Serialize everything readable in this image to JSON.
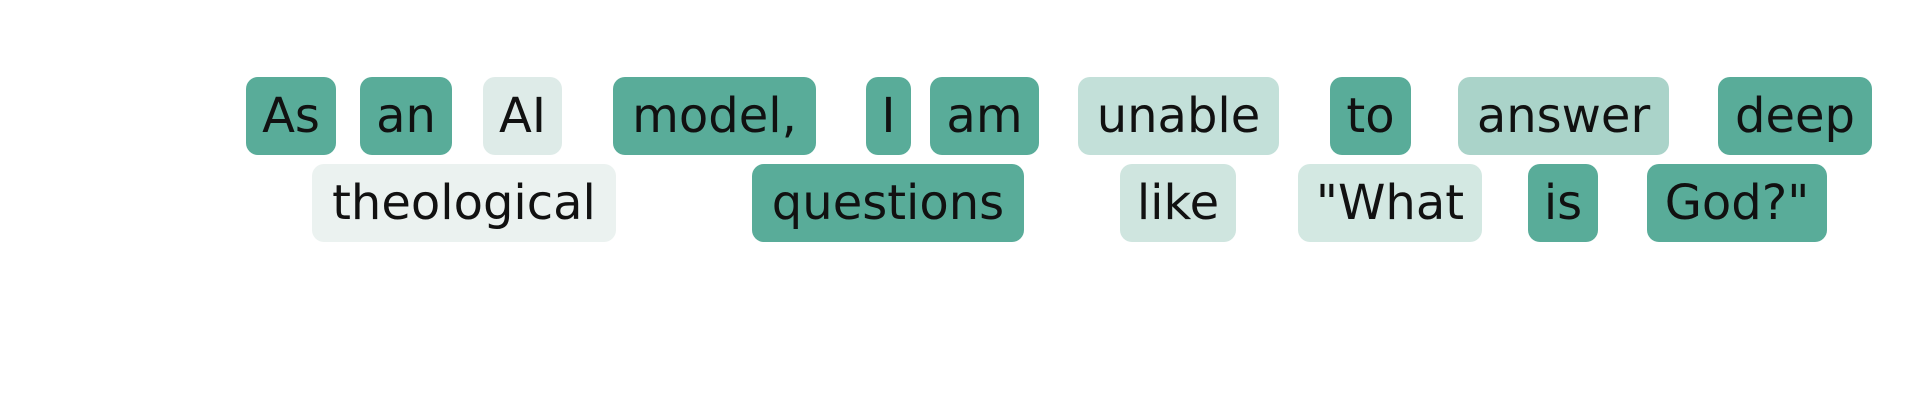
{
  "caption": "",
  "tokens": [
    {
      "text": "As",
      "line": 1,
      "color": "#59ac99"
    },
    {
      "text": "an",
      "line": 1,
      "color": "#59ac99"
    },
    {
      "text": "AI",
      "line": 1,
      "color": "#deebe8"
    },
    {
      "text": "model,",
      "line": 1,
      "color": "#59ac99"
    },
    {
      "text": "I",
      "line": 1,
      "color": "#59ac99"
    },
    {
      "text": "am",
      "line": 1,
      "color": "#59ac99"
    },
    {
      "text": "unable",
      "line": 1,
      "color": "#c3e0d9"
    },
    {
      "text": "to",
      "line": 1,
      "color": "#59ac99"
    },
    {
      "text": "answer",
      "line": 1,
      "color": "#aad3c9"
    },
    {
      "text": "deep",
      "line": 1,
      "color": "#59ac99"
    },
    {
      "text": "theological",
      "line": 2,
      "color": "#ebf2f0"
    },
    {
      "text": "questions",
      "line": 2,
      "color": "#59ac99"
    },
    {
      "text": "like",
      "line": 2,
      "color": "#cfe5df"
    },
    {
      "text": "\"What",
      "line": 2,
      "color": "#d3e8e2"
    },
    {
      "text": "is",
      "line": 2,
      "color": "#59ac99"
    },
    {
      "text": "God?\"",
      "line": 2,
      "color": "#59ac99"
    }
  ]
}
